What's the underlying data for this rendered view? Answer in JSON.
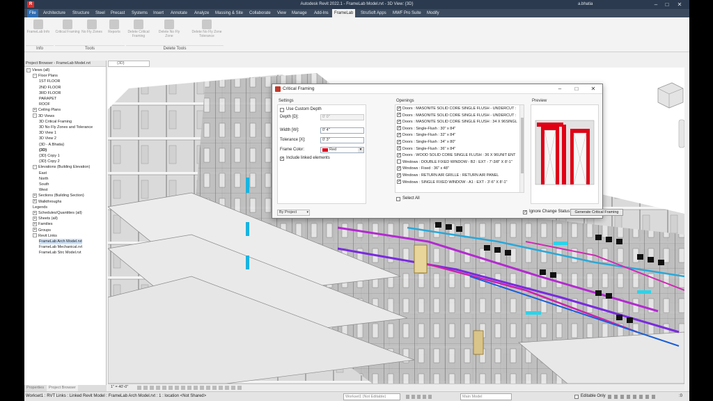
{
  "titlebar": {
    "app_icon": "R",
    "title": "Autodesk Revit 2022.1 - FrameLab Model.rvt - 3D View: {3D}",
    "user": "a.bhatia",
    "minimize": "–",
    "maximize": "□",
    "close": "✕"
  },
  "menu": {
    "tabs": [
      "File",
      "Architecture",
      "Structure",
      "Steel",
      "Precast",
      "Systems",
      "Insert",
      "Annotate",
      "Analyze",
      "Massing & Site",
      "Collaborate",
      "View",
      "Manage",
      "Add-Ins",
      "FrameLab",
      "StruSoft Apps",
      "MWF Pro Suite",
      "Modify"
    ],
    "active": "FrameLab"
  },
  "ribbon": {
    "buttons": [
      "FrameLab Info",
      "Critical Framing",
      "No Fly Zones",
      "Reports",
      "Delete Critical Framing",
      "Delete No Fly Zone",
      "Delete No Fly Zone Tolerance"
    ],
    "groups": [
      "Info",
      "Tools",
      "Delete Tools"
    ]
  },
  "browser": {
    "header": "Project Browser - FrameLab Model.rvt",
    "items": [
      {
        "label": "Views (all)",
        "toggle": "-"
      },
      {
        "label": "Floor Plans",
        "toggle": "-"
      },
      {
        "label": "1ST FLOOR"
      },
      {
        "label": "2ND FLOOR"
      },
      {
        "label": "3RD FLOOR"
      },
      {
        "label": "PARAPET"
      },
      {
        "label": "ROOF"
      },
      {
        "label": "Ceiling Plans",
        "toggle": "+"
      },
      {
        "label": "3D Views",
        "toggle": "-"
      },
      {
        "label": "3D Critical Framing"
      },
      {
        "label": "3D No Fly Zones and Tolerance"
      },
      {
        "label": "3D View 1"
      },
      {
        "label": "3D View 2"
      },
      {
        "label": "{3D - A.Bhatia}"
      },
      {
        "label": "{3D}",
        "bold": true
      },
      {
        "label": "{3D} Copy 1"
      },
      {
        "label": "{3D} Copy 2"
      },
      {
        "label": "Elevations (Building Elevation)",
        "toggle": "-"
      },
      {
        "label": "East"
      },
      {
        "label": "North"
      },
      {
        "label": "South"
      },
      {
        "label": "West"
      },
      {
        "label": "Sections (Building Section)",
        "toggle": "+"
      },
      {
        "label": "Walkthroughs",
        "toggle": "+"
      },
      {
        "label": "Legends"
      },
      {
        "label": "Schedules/Quantities (all)",
        "toggle": "+"
      },
      {
        "label": "Sheets (all)",
        "toggle": "+"
      },
      {
        "label": "Families",
        "toggle": "+"
      },
      {
        "label": "Groups",
        "toggle": "+"
      },
      {
        "label": "Revit Links",
        "toggle": "-"
      },
      {
        "label": "FrameLab Arch Model.rvt",
        "selected": true
      },
      {
        "label": "FrameLab Mechanical.rvt"
      },
      {
        "label": "FrameLab Strc Model.rvt"
      }
    ],
    "tabs": [
      "Properties",
      "Project Browser"
    ]
  },
  "view_tab": "{3D}",
  "view_control": {
    "scale": "1\" = 40'-0\""
  },
  "dialog": {
    "title": "Critical Framing",
    "minimize": "–",
    "maximize": "□",
    "close": "✕",
    "settings": {
      "label": "Settings",
      "use_custom_depth": "Use Custom Depth",
      "depth_label": "Depth [D]:",
      "depth_value": "0' 0\"",
      "width_label": "Width [W]:",
      "width_value": "0' 4\"",
      "tolerance_label": "Tolerance [X]:",
      "tolerance_value": "0' 3\"",
      "frame_color_label": "Frame Color:",
      "frame_color_value": "Red",
      "frame_color_swatch": "#e0001b",
      "include_linked": "Include linked elements"
    },
    "openings": {
      "label": "Openings",
      "items": [
        {
          "text": "Doors : MASONITE SOLID CORE SINGLE FLUSH - UNDERCUT : ",
          "checked": true
        },
        {
          "text": "Doors : MASONITE SOLID CORE SINGLE FLUSH - UNDERCUT :",
          "checked": true
        },
        {
          "text": "Doors : MASONITE SOLID CORE SINGLE FLUSH : 34 X 96SINGL",
          "checked": true
        },
        {
          "text": "Doors : Single-Flush : 30\" x 84\"",
          "checked": true
        },
        {
          "text": "Doors : Single-Flush : 32\" x 84\"",
          "checked": true
        },
        {
          "text": "Doors : Single-Flush : 34\" x 80\"",
          "checked": true
        },
        {
          "text": "Doors : Single-Flush : 36\" x 84\"",
          "checked": true
        },
        {
          "text": "Doors : WOOD SOLID CORE SINGLE FLUSH : 36 X 96UNIT ENT",
          "checked": true
        },
        {
          "text": "Windows : DOUBLE FIXED WINDOW - B2 : EXT - 7'-3/8\" X 8'-1\"",
          "checked": false
        },
        {
          "text": "Windows : Fixed : 36\" x 48\"",
          "checked": true
        },
        {
          "text": "Windows : RETURN AIR GRILLE : RETURN AIR PANEL",
          "checked": true
        },
        {
          "text": "Windows : SINGLE FIXED WINDOW - A1 : EXT - 3'-6\" X 8'-1\"",
          "checked": true
        }
      ],
      "select_all": "Select All"
    },
    "preview_label": "Preview",
    "by_project": "By Project",
    "ignore_change_status": "Ignore Change Status",
    "generate_button": "Generate Critical Framing"
  },
  "status": {
    "text": "Workset1 : RVT Links : Linked Revit Model : FrameLab Arch Model.rvt : 1 : location <Not Shared>",
    "workset": "Workset1 (Not Editable)",
    "model": "Main Model",
    "editable_only": "Editable Only",
    "filter_count": ":0"
  }
}
